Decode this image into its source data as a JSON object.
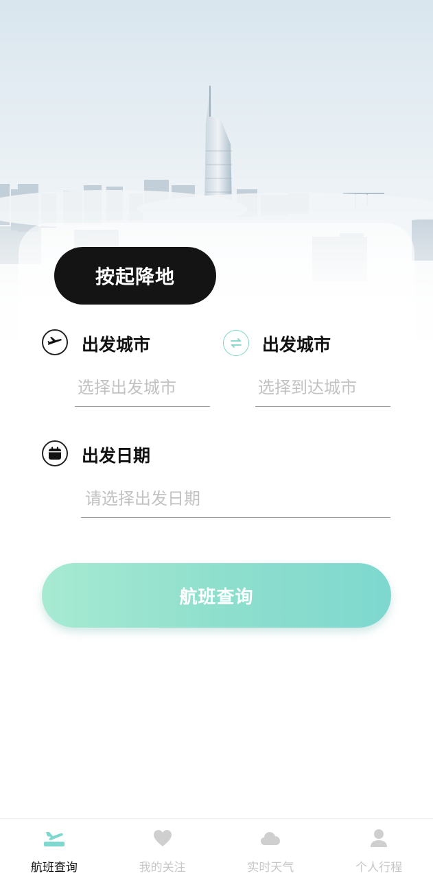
{
  "colors": {
    "accent": "#7ed8cf",
    "accent_light": "#a7ead2",
    "dark": "#141414",
    "placeholder": "#c2c2c2",
    "inactive": "#c7c7c7"
  },
  "mode_toggle": {
    "label": "按起降地"
  },
  "departure": {
    "icon": "plane-icon",
    "label": "出发城市",
    "placeholder": "选择出发城市"
  },
  "arrival": {
    "icon": "swap-icon",
    "label": "出发城市",
    "placeholder": "选择到达城市"
  },
  "date": {
    "icon": "calendar-icon",
    "label": "出发日期",
    "placeholder": "请选择出发日期"
  },
  "search_button": {
    "label": "航班查询"
  },
  "bottom_nav": {
    "items": [
      {
        "label": "航班查询",
        "icon": "flight-icon",
        "active": true
      },
      {
        "label": "我的关注",
        "icon": "heart-icon",
        "active": false
      },
      {
        "label": "实时天气",
        "icon": "cloud-icon",
        "active": false
      },
      {
        "label": "个人行程",
        "icon": "user-icon",
        "active": false
      }
    ]
  }
}
